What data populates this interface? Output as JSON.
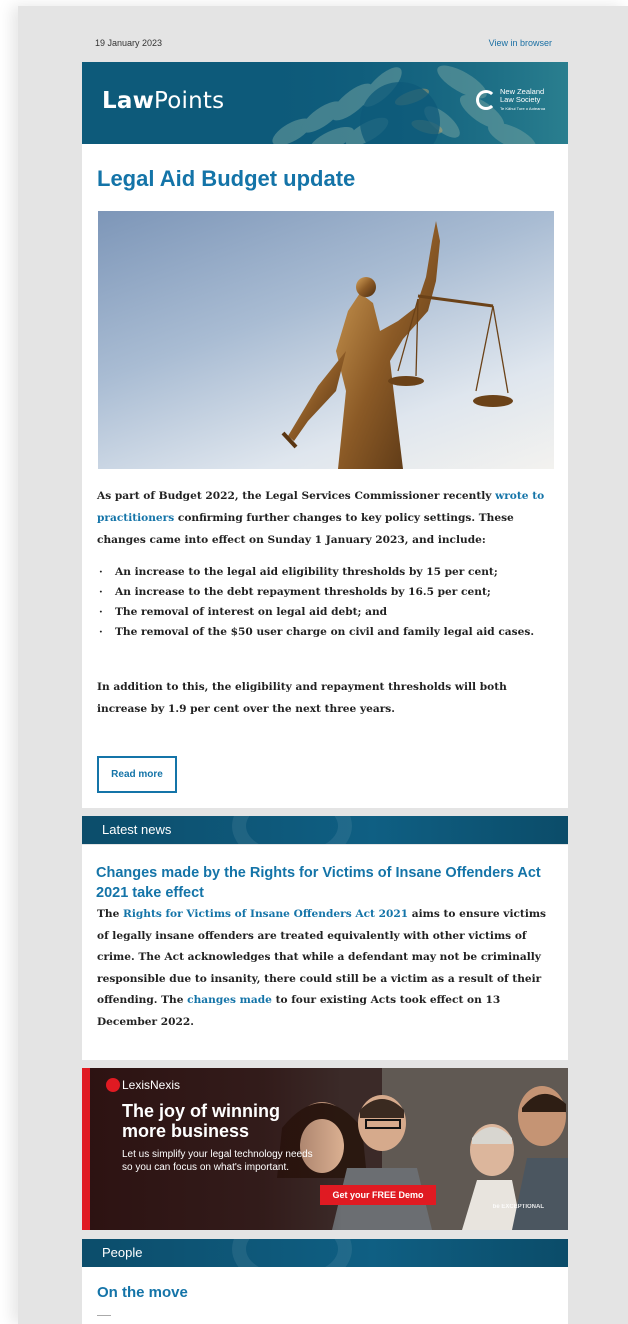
{
  "topbar": {
    "date": "19 January 2023",
    "view_in_browser": "View in browser"
  },
  "header": {
    "logo_bold": "Law",
    "logo_light": "Points",
    "society_line1": "New Zealand",
    "society_line2": "Law Society",
    "society_tagline": "Te Kāhui Ture o Aotearoa"
  },
  "article": {
    "title": "Legal Aid Budget update",
    "hero_alt": "Statue of Lady Justice holding scales and a sword",
    "intro_before": "As part of Budget 2022, the Legal Services Commissioner recently ",
    "intro_link": "wrote to practitioners",
    "intro_after": " confirming further changes to key policy settings. These changes came into effect on Sunday 1 January 2023, and include:",
    "bullets": [
      "An increase to the legal aid eligibility thresholds by 15 per cent;",
      "An increase to the debt repayment thresholds by 16.5 per cent;",
      "The removal of interest on legal aid debt; and",
      "The removal of the $50 user charge on civil and family legal aid cases."
    ],
    "closing": "In addition to this, the eligibility and repayment thresholds will both increase by 1.9 per cent over the next three years.",
    "read_more": "Read more"
  },
  "latest_news": {
    "section_label": "Latest news",
    "title": "Changes made by the Rights for Victims of Insane Offenders Act 2021 take effect",
    "body_pre": "The ",
    "body_link1": "Rights for Victims of Insane Offenders Act 2021",
    "body_mid": " aims to ensure victims of legally insane offenders are treated equivalently with other victims of crime. The Act acknowledges that while a defendant may not be criminally responsible due to insanity, there could still be a victim as a result of their offending. The ",
    "body_link2": "changes made",
    "body_post": " to four existing Acts took effect on 13 December 2022."
  },
  "ad": {
    "brand": "LexisNexis",
    "headline": "The joy of winning more business",
    "subtext": "Let us simplify your legal technology needs so you can focus on what's important.",
    "cta": "Get your FREE Demo",
    "tag": "be EXCEPTIONAL"
  },
  "people": {
    "section_label": "People",
    "title": "On the move"
  },
  "colors": {
    "accent": "#1474a8",
    "band": "#0f5f83",
    "ad_red": "#e01a22"
  }
}
